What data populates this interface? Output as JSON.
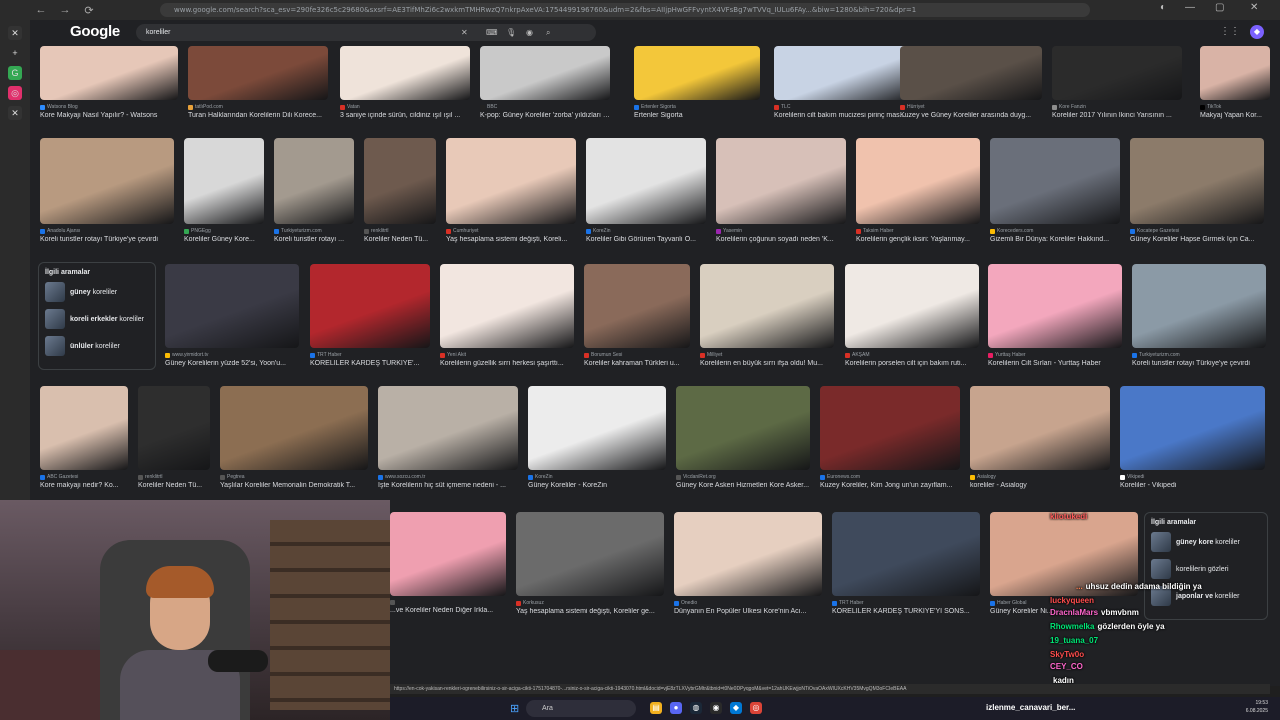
{
  "browser": {
    "url": "www.google.com/search?sca_esv=290fe326c5c29680&sxsrf=AE3TifMhZi6c2wxkmTMHRwzQ7nkrpAxeVA:1754499196760&udm=2&fbs=AIIjpHwGFFvyntX4VFsBg7wTVVq_IULu6FAy...&biw=1280&bih=720&dpr=1"
  },
  "google": {
    "logo": "Google",
    "query": "koreliler"
  },
  "rows": [
    [
      {
        "source": "Watsons Blog",
        "caption": "Kore Makyajı Nasıl Yapılır? - Watsons",
        "color": "#e6c7b8",
        "accent": "#2d8cff"
      },
      {
        "source": "tatlıPod.com",
        "caption": "Turan Halklarından Korelilerin Dili Korece...",
        "color": "#7c4a3a",
        "accent": "#e8a13a"
      },
      {
        "source": "Vatan",
        "caption": "3 saniye içinde sürün, cildiniz ışıl ışıl ...",
        "color": "#efe3da",
        "accent": "#d93025"
      },
      {
        "source": "BBC",
        "caption": "K-pop: Güney Koreliler 'zorba' yıldızları i...",
        "color": "#c9c9c9",
        "accent": "#222222"
      },
      {
        "source": "Ertenler Sigorta",
        "caption": "Ertenler Sigorta",
        "color": "#f3c73a",
        "accent": "#1a73e8"
      },
      {
        "source": "TLC",
        "caption": "Korelilerin cilt bakım mucizesi pirinç mas...",
        "color": "#c8d3e4",
        "accent": "#d93025"
      },
      {
        "source": "Hürriyet",
        "caption": "Kuzey ve Güney Koreliler arasında duyg...",
        "color": "#5a5048",
        "accent": "#d93025"
      },
      {
        "source": "Kore Fanzin",
        "caption": "Koreliler 2017 Yılının İkinci Yarısının ...",
        "color": "#2b2b2b",
        "accent": "#8e8e8e"
      },
      {
        "source": "TikTok",
        "caption": "Makyaj Yapan Kor...",
        "color": "#d9b3a6",
        "accent": "#000000"
      }
    ],
    [
      {
        "source": "Anadolu Ajansı",
        "caption": "Koreli turistler rotayı Türkiye'ye çevirdi",
        "color": "#b89a80",
        "accent": "#1a73e8"
      },
      {
        "source": "PNGEgg",
        "caption": "Koreliler Güney Kore...",
        "color": "#d8d8d8",
        "accent": "#34a853"
      },
      {
        "source": "Turkiyeturizm.com",
        "caption": "Koreli turistler rotayı ...",
        "color": "#a39a8f",
        "accent": "#1a73e8"
      },
      {
        "source": "renklitrtl",
        "caption": "Koreliler Neden Tü...",
        "color": "#6e5a4e",
        "accent": "#555555"
      },
      {
        "source": "Cumhuriyet",
        "caption": "Yaş hesaplama sistemi değişti, Koreli...",
        "color": "#e8c9b8",
        "accent": "#d93025"
      },
      {
        "source": "KoreZin",
        "caption": "Koreliler Gibi Görünen Tayvanlı O...",
        "color": "#e3e3e3",
        "accent": "#1a73e8"
      },
      {
        "source": "Yasemin",
        "caption": "Korelilerin çoğunun soyadı neden 'K...",
        "color": "#d7c0b8",
        "accent": "#9c27b0"
      },
      {
        "source": "Taksim Haber",
        "caption": "Korelilerin gençlik iksiri: Yaşlanmay...",
        "color": "#f0c2ad",
        "accent": "#d93025"
      },
      {
        "source": "Koreceders.com",
        "caption": "Gizemli Bir Dünya: Koreliler Hakkınd...",
        "color": "#6a6f7a",
        "accent": "#fbbc04"
      },
      {
        "source": "Kocatepe Gazetesi",
        "caption": "Güney Koreliler Hapse Girmek İçin Ca...",
        "color": "#8c7b6a",
        "accent": "#1a73e8"
      }
    ],
    [
      {
        "source": "www.yirmidort.tv",
        "caption": "Güney Korelilerin yüzde 52'si, Yoon'u...",
        "color": "#3a3a45",
        "accent": "#fbbc04"
      },
      {
        "source": "TRT Haber",
        "caption": "KORELİLER KARDEŞ TÜRKİYE'...",
        "color": "#b3272d",
        "accent": "#1a73e8"
      },
      {
        "source": "Yeni Akit",
        "caption": "Korelilerin güzellik sırrı herkesi şaşırttı...",
        "color": "#f2e6e0",
        "accent": "#d93025"
      },
      {
        "source": "Borumun Sesi",
        "caption": "Koreliler kahraman Türkleri u...",
        "color": "#8a6a5a",
        "accent": "#d93025"
      },
      {
        "source": "Milliyet",
        "caption": "Korelilerin en büyük sırrı ifşa oldu! Mu...",
        "color": "#d9cfc0",
        "accent": "#d93025"
      },
      {
        "source": "AKŞAM",
        "caption": "Korelilerin porselen cilt için bakım ruti...",
        "color": "#efe9e4",
        "accent": "#d93025"
      },
      {
        "source": "Yurttaş Haber",
        "caption": "Korelilerin Cilt Sırları - Yurttaş Haber",
        "color": "#f3a7bd",
        "accent": "#e91e63"
      },
      {
        "source": "Turkiyeturizm.com",
        "caption": "Koreli turistler rotayı Türkiye'ye çevirdi",
        "color": "#8b9aa6",
        "accent": "#1a73e8"
      }
    ],
    [
      {
        "source": "ABC Gazetesi",
        "caption": "Kore makyajı nedir? Ko...",
        "color": "#d9bfae",
        "accent": "#1a73e8"
      },
      {
        "source": "renklitrtl",
        "caption": "Koreliler Neden Tü...",
        "color": "#2e2e2e",
        "accent": "#555555"
      },
      {
        "source": "Pegtrea",
        "caption": "Yaşlılar Koreliler Memorialin Demokratik T...",
        "color": "#8c6e52",
        "accent": "#555555"
      },
      {
        "source": "www.sozcu.com.tr",
        "caption": "İşte Korelilerin hiç süt içmeme nedeni - ...",
        "color": "#b9b0a6",
        "accent": "#1a73e8"
      },
      {
        "source": "KoreZin",
        "caption": "Güney Koreliler - KoreZin",
        "color": "#ececec",
        "accent": "#1a73e8"
      },
      {
        "source": "VicdaniRet.org",
        "caption": "Güney Kore Askeri Hizmetleri Kore Asker...",
        "color": "#5d6a45",
        "accent": "#555555"
      },
      {
        "source": "Euronews.com",
        "caption": "Kuzey Koreliler, Kim Jong un'un zayıflam...",
        "color": "#7a2a2a",
        "accent": "#1a73e8"
      },
      {
        "source": "Asialogy",
        "caption": "koreliler - Asialogy",
        "color": "#c7a48e",
        "accent": "#fbbc04"
      },
      {
        "source": "Vikipedi",
        "caption": "Koreliler - Vikipedi",
        "color": "#4a78c8",
        "accent": "#ffffff"
      }
    ],
    [
      {
        "source": "",
        "caption": "...ve Koreliler Neden Diğer Irkla...",
        "color": "#ef9fb0",
        "accent": "#555555"
      },
      {
        "source": "Korkusuz",
        "caption": "Yaş hesaplama sistemi değişti, Koreliler ge...",
        "color": "#6b6b6b",
        "accent": "#d93025"
      },
      {
        "source": "Onedio",
        "caption": "Dünyanın En Popüler Ülkesi Kore'nin Acı...",
        "color": "#e6cfc0",
        "accent": "#1a73e8"
      },
      {
        "source": "TRT Haber",
        "caption": "KORELİLER KARDEŞ TÜRKİYE'Yİ SONS...",
        "color": "#3f4a5c",
        "accent": "#1a73e8"
      },
      {
        "source": "Haber Global",
        "caption": "Güney Koreliler Ni...",
        "color": "#d9a58e",
        "accent": "#1a73e8"
      }
    ]
  ],
  "related": {
    "title": "İlgili aramalar",
    "items": [
      {
        "bold": "güney",
        "rest": " koreliler"
      },
      {
        "bold": "koreli erkekler",
        "rest": " koreliler"
      },
      {
        "bold": "ünlüler",
        "rest": " koreliler"
      }
    ]
  },
  "related2": {
    "title": "İlgili aramalar",
    "items": [
      {
        "bold": "güney kore",
        "rest": " koreliler"
      },
      {
        "bold": "",
        "rest": "korelilerin gözleri"
      },
      {
        "bold": "japonlar ve",
        "rest": " koreliler"
      }
    ]
  },
  "chat": [
    {
      "user": "kliotukedi",
      "msg": "",
      "color": "#ff5b5b"
    },
    {
      "user": "...",
      "msg": "uhsuz dedin adama bildiğin ya",
      "color": "#ff7f50"
    },
    {
      "user": "luckyqueen",
      "msg": "",
      "color": "#ff4d4d"
    },
    {
      "user": "DracnlaMars",
      "msg": "vbmvbnm",
      "color": "#ff66cc"
    },
    {
      "user": "Rhowmelka",
      "msg": "gözlerden öyle ya",
      "color": "#00e676"
    },
    {
      "user": "19_tuana_07",
      "msg": "",
      "color": "#00e676"
    },
    {
      "user": "SkyTw0o",
      "msg": "",
      "color": "#ff4d4d"
    },
    {
      "user": "CEY_CO",
      "msg": "",
      "color": "#ff66cc"
    },
    {
      "user": "",
      "msg": "kadın",
      "color": "#ff4d4d"
    }
  ],
  "status_url": "https://en-cok-yakisan-renkleri-ogrenebilirsiniz-o-sir-aciga-cikti-1751704870-...rsiniz-o-sir-aciga-cikti-1943070.html&docid=vjE8zTLXVybrGMtr&tbnid=t0Ne0DPyqgoM&vet=12ahUKEwjjoNTiOvaOAxWIUXcKHV35MvgQM3oFCIeBEAA",
  "taskbar": {
    "search_placeholder": "Ara",
    "title": "izlenme_canavari_ber...",
    "time": "19:53",
    "date": "6.08.2025"
  }
}
